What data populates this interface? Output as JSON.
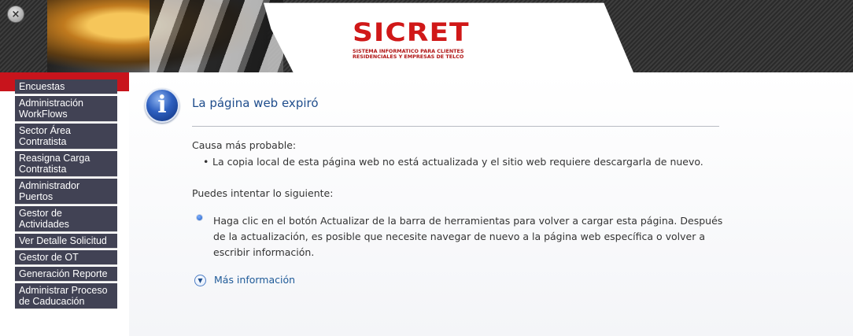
{
  "header": {
    "logo_text": "SICRET",
    "logo_subtitle_1": "SISTEMA INFORMATICO PARA CLIENTES",
    "logo_subtitle_2": "RESIDENCIALES Y EMPRESAS DE TELCO",
    "close_glyph": "×"
  },
  "sidebar": {
    "items": [
      {
        "label": "Encuestas"
      },
      {
        "label": "Administración WorkFlows"
      },
      {
        "label": "Sector Área Contratista"
      },
      {
        "label": "Reasigna Carga Contratista"
      },
      {
        "label": "Administrador Puertos"
      },
      {
        "label": "Gestor de Actividades"
      },
      {
        "label": "Ver Detalle Solicitud"
      },
      {
        "label": "Gestor de OT"
      },
      {
        "label": "Generación Reporte"
      },
      {
        "label": "Administrar Proceso de Caducación"
      }
    ]
  },
  "main": {
    "info_icon": "info-icon",
    "title": "La página web expiró",
    "cause_heading": "Causa más probable:",
    "cause_bullet": "•",
    "cause_item": "La copia local de esta página web no está actualizada y el sitio web requiere descargarla de nuevo.",
    "try_heading": "Puedes intentar lo siguiente:",
    "suggestion": "Haga clic en el botón Actualizar de la barra de herramientas para volver a cargar esta página. Después de la actualización, es posible que necesite navegar de nuevo a la página web específica o volver a escribir información.",
    "more_info": "Más información",
    "more_icon_glyph": "▼"
  },
  "colors": {
    "nav_bg": "#414254",
    "accent_red": "#c8141c",
    "title_blue": "#1f4d8c",
    "link_blue": "#1e5a98"
  }
}
